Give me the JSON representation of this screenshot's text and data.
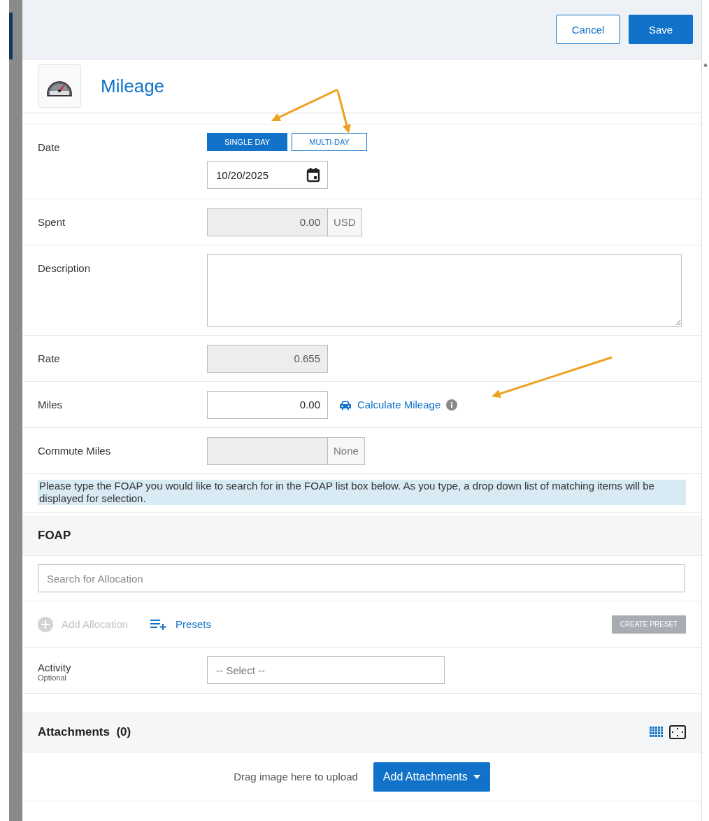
{
  "header": {
    "buttons": [
      {
        "label": "Cancel",
        "kind": "secondary"
      },
      {
        "label": "Save",
        "kind": "primary"
      }
    ]
  },
  "title": "Mileage",
  "rows": [
    {
      "kind": "date",
      "label": "Date",
      "options": [
        {
          "label": "SINGLE DAY",
          "selected": true
        },
        {
          "label": "MULTI-DAY",
          "selected": false
        }
      ],
      "value": "10/20/2025"
    },
    {
      "kind": "amount",
      "label": "Spent",
      "value": "0.00",
      "unit": "USD",
      "disabled": true
    },
    {
      "kind": "textarea",
      "label": "Description"
    },
    {
      "kind": "amount",
      "label": "Rate",
      "value": "0.655",
      "disabled": true
    },
    {
      "kind": "amount",
      "label": "Miles",
      "value": "0.00",
      "disabled": false,
      "link": "Calculate Mileage"
    },
    {
      "kind": "amount",
      "label": "Commute Miles",
      "unit": "None",
      "disabled": true
    }
  ],
  "note": "Please type the FOAP you would like to search for in the FOAP list box below. As you type, a drop down list of matching items will be displayed for selection.",
  "foap": {
    "title": "FOAP",
    "search": {
      "placeholder": "Search for Allocation"
    },
    "actions": [
      {
        "label": "Add Allocation",
        "disabled": true
      },
      {
        "label": "Presets",
        "disabled": false
      }
    ],
    "create_preset": {
      "label": "CREATE PRESET",
      "disabled": true
    },
    "activity": {
      "label": "Activity",
      "sublabel": "Optional",
      "placeholder": "-- Select --"
    }
  },
  "attachments": {
    "title": "Attachments",
    "count": "(0)",
    "drop_text": "Drag image here to upload",
    "button": "Add Attachments"
  }
}
